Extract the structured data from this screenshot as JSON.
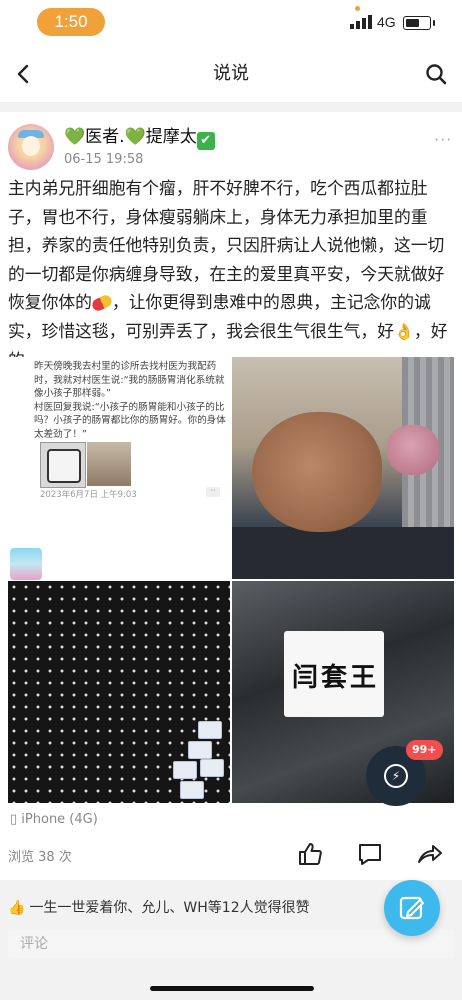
{
  "status_bar": {
    "time": "1:50",
    "network": "4G",
    "battery_percent": 60,
    "accent": "#f0a13a"
  },
  "nav": {
    "title": "说说",
    "back_icon": "chevron-left-icon",
    "search_icon": "search-icon"
  },
  "post": {
    "author": "医者.",
    "author_suffix": "提摩太",
    "time": "06-15 19:58",
    "more": "···",
    "text_before_pill": "主内弟兄肝细胞有个瘤，肝不好脾不行，吃个西瓜都拉肚子，胃也不行，身体瘦弱躺床上，身体无力承担加里的重担，养家的责任他特别负责，只因肝病让人说他懒，这一切的一切都是你病缠身导致，在主的爱里真平安，今天就做好恢复你体的",
    "text_after_pill": "，让你更得到患难中的恩典，主记念你的诚实，珍惜这毯，可别弄丢了，我会很生气很生气，好",
    "text_end": "，好的",
    "screenshot": {
      "line1": "昨天傍晚我去村里的诊所去找村医为我配药时，我就对村医生说:“我的肠肠胃消化系统就像小孩子那样弱。”",
      "line2": "村医回复我说:“小孩子的肠胃能和小孩子的比吗？小孩子的肠胃都比你的肠胃好。你的身体太差劲了！”",
      "date": "2023年6月7日 上午9:03",
      "dots": "··"
    },
    "label_text": "闫套王",
    "badge": "99+",
    "device": "iPhone (4G)",
    "views": "浏览 38 次"
  },
  "likes_text": "一生一世爱着你、允儿、WH等12人觉得很赞",
  "comment_placeholder": "评论"
}
